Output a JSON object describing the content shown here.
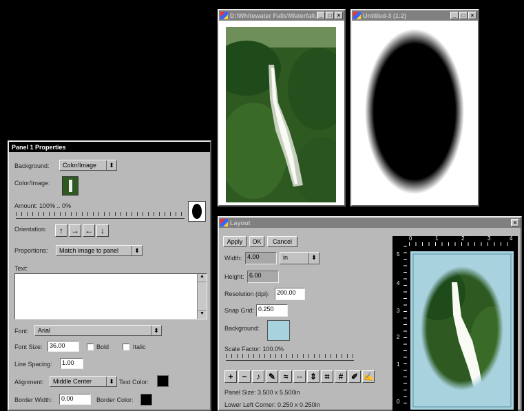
{
  "waterfall_window": {
    "title": "D:\\Whitewater Falls\\Waterfall.jpg"
  },
  "untitled_window": {
    "title": "Untitled-3 (1:2)"
  },
  "panel": {
    "title": "Panel 1 Properties",
    "background_label": "Background:",
    "background_value": "Color/Image",
    "colorimage_label": "Color/Image:",
    "amount_label": "Amount: 100% .. 0%",
    "orientation_label": "Orientation:",
    "proportions_label": "Proportions:",
    "proportions_value": "Match image to panel",
    "text_label": "Text:",
    "font_label": "Font:",
    "font_value": "Arial",
    "fontsize_label": "Font Size:",
    "fontsize_value": "36.00",
    "bold_label": "Bold",
    "italic_label": "Italic",
    "linespacing_label": "Line Spacing:",
    "linespacing_value": "1.00",
    "alignment_label": "Alignment:",
    "alignment_value": "Middle Center",
    "textcolor_label": "Text Color:",
    "borderwidth_label": "Border Width:",
    "borderwidth_value": "0.00",
    "bordercolor_label": "Border Color:"
  },
  "layout": {
    "title": "Layout",
    "apply": "Apply",
    "ok": "OK",
    "cancel": "Cancel",
    "width_label": "Width:",
    "width_value": "4.00",
    "unit_value": "in",
    "height_label": "Height:",
    "height_value": "6.00",
    "resolution_label": "Resolution (dpi):",
    "resolution_value": "200.00",
    "snap_label": "Snap Grid:",
    "snap_value": "0.250",
    "bg_label": "Background:",
    "bg_color": "#a8d2de",
    "scale_label": "Scale Factor: 100.0%",
    "panel_size": "Panel Size: 3.500 x 5.500in",
    "lower_left": "Lower Left Corner: 0.250 x 0.250in",
    "ruler_top": [
      "0",
      "1",
      "2",
      "3",
      "4"
    ],
    "ruler_left": [
      "5",
      "4",
      "3",
      "2",
      "1",
      "0"
    ]
  }
}
